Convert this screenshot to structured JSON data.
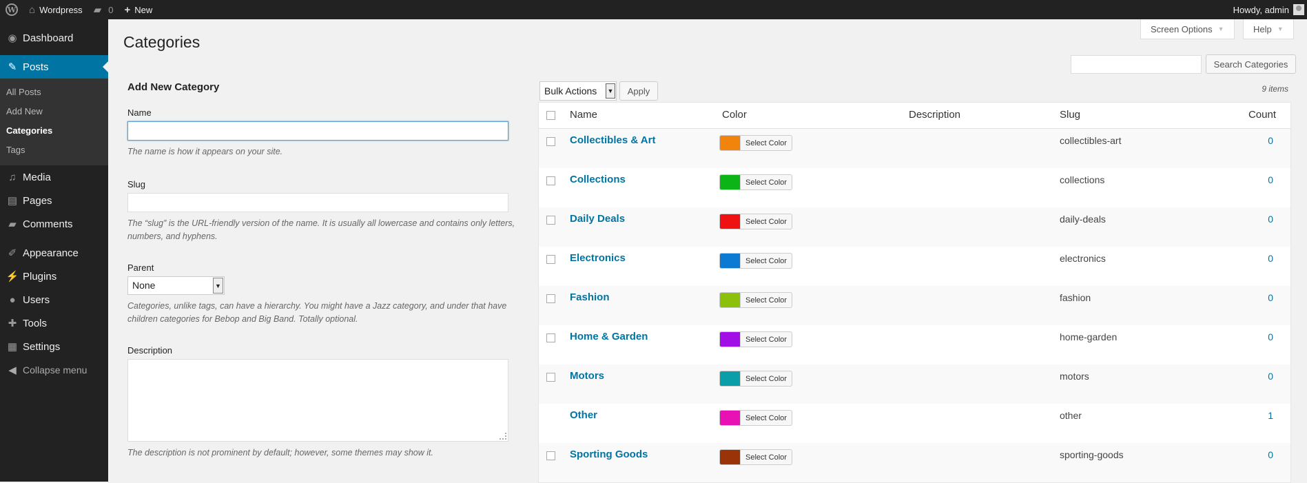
{
  "adminbar": {
    "site_name": "Wordpress",
    "comments_count": "0",
    "new_label": "New",
    "greeting": "Howdy, admin"
  },
  "sidebar": {
    "dashboard": "Dashboard",
    "posts": "Posts",
    "submenu": [
      "All Posts",
      "Add New",
      "Categories",
      "Tags"
    ],
    "media": "Media",
    "pages": "Pages",
    "comments": "Comments",
    "appearance": "Appearance",
    "plugins": "Plugins",
    "users": "Users",
    "tools": "Tools",
    "settings": "Settings",
    "collapse": "Collapse menu"
  },
  "page": {
    "title": "Categories",
    "screen_options": "Screen Options",
    "help": "Help",
    "search_value": "",
    "search_button": "Search Categories"
  },
  "form": {
    "heading": "Add New Category",
    "name_label": "Name",
    "name_value": "",
    "name_desc": "The name is how it appears on your site.",
    "slug_label": "Slug",
    "slug_value": "",
    "slug_desc": "The “slug” is the URL-friendly version of the name. It is usually all lowercase and contains only letters, numbers, and hyphens.",
    "parent_label": "Parent",
    "parent_value": "None",
    "parent_desc": "Categories, unlike tags, can have a hierarchy. You might have a Jazz category, and under that have children categories for Bebop and Big Band. Totally optional.",
    "description_label": "Description",
    "description_desc": "The description is not prominent by default; however, some themes may show it."
  },
  "table": {
    "bulk_actions": "Bulk Actions",
    "apply": "Apply",
    "items_count": "9 items",
    "headers": {
      "name": "Name",
      "color": "Color",
      "description": "Description",
      "slug": "Slug",
      "count": "Count"
    },
    "select_color_label": "Select Color",
    "rows": [
      {
        "name": "Collectibles & Art",
        "color": "#f0840c",
        "slug": "collectibles-art",
        "count": "0",
        "checkbox": true
      },
      {
        "name": "Collections",
        "color": "#0db418",
        "slug": "collections",
        "count": "0",
        "checkbox": true
      },
      {
        "name": "Daily Deals",
        "color": "#ee1212",
        "slug": "daily-deals",
        "count": "0",
        "checkbox": true
      },
      {
        "name": "Electronics",
        "color": "#0c7ad2",
        "slug": "electronics",
        "count": "0",
        "checkbox": true
      },
      {
        "name": "Fashion",
        "color": "#8bc10b",
        "slug": "fashion",
        "count": "0",
        "checkbox": true
      },
      {
        "name": "Home & Garden",
        "color": "#a10ee6",
        "slug": "home-garden",
        "count": "0",
        "checkbox": true
      },
      {
        "name": "Motors",
        "color": "#0a9ea8",
        "slug": "motors",
        "count": "0",
        "checkbox": true
      },
      {
        "name": "Other",
        "color": "#e812b4",
        "slug": "other",
        "count": "1",
        "checkbox": false
      },
      {
        "name": "Sporting Goods",
        "color": "#9a3308",
        "slug": "sporting-goods",
        "count": "0",
        "checkbox": true
      }
    ]
  },
  "colors": {
    "admin_bar": "#222222",
    "sidebar": "#222222",
    "accent": "#0074a2",
    "background": "#f1f1f1"
  }
}
